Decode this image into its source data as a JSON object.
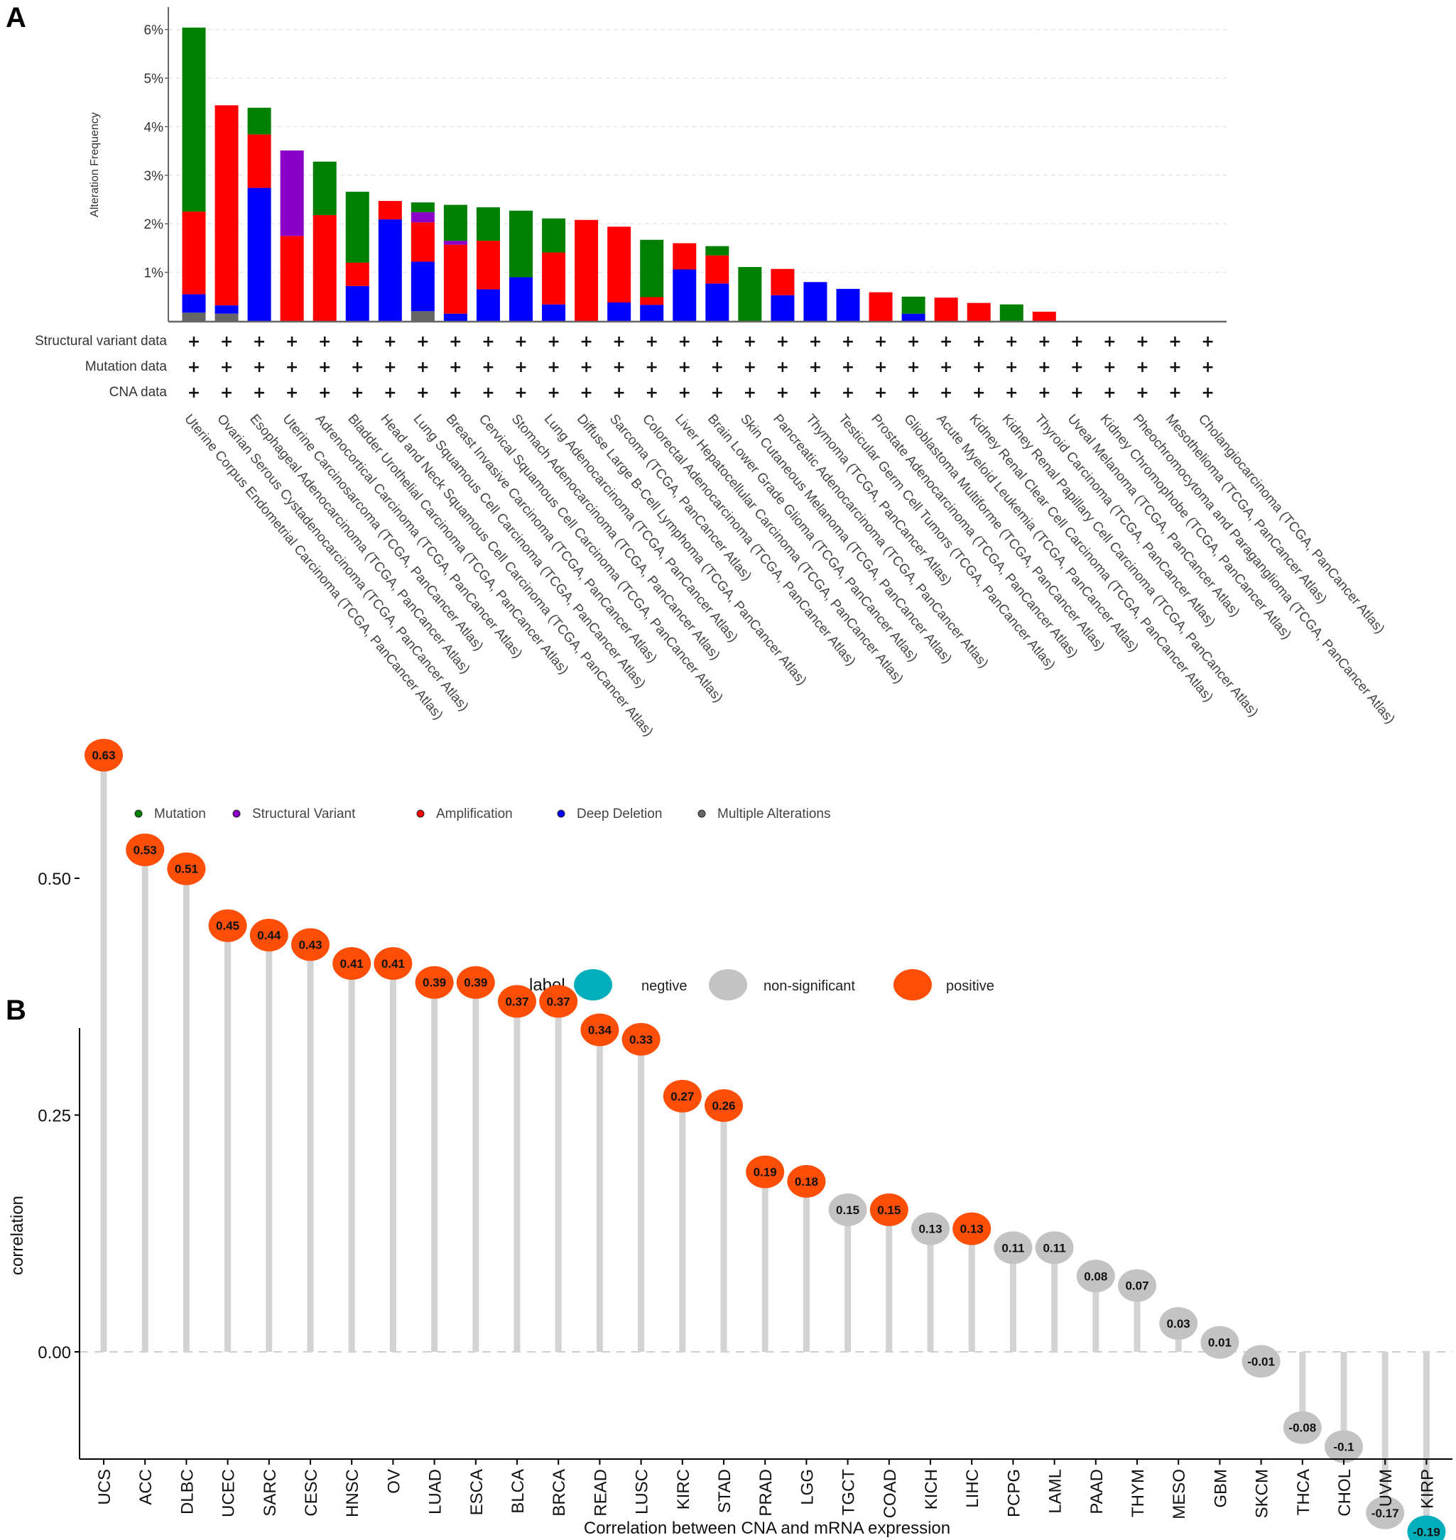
{
  "chart_data": [
    {
      "panel": "A",
      "type": "bar",
      "stacked": true,
      "title": "",
      "xlabel": "",
      "ylabel": "Alteration Frequency",
      "ylim": [
        0,
        6.5
      ],
      "yticks": [
        "1%",
        "2%",
        "3%",
        "4%",
        "5%",
        "6%"
      ],
      "ytick_values": [
        1,
        2,
        3,
        4,
        5,
        6
      ],
      "grid": true,
      "legend_position": "bottom",
      "segment_order": [
        "multiple",
        "deep_deletion",
        "amplification",
        "structural_variant",
        "mutation"
      ],
      "legend": [
        {
          "key": "mutation",
          "name": "Mutation",
          "color": "#008000"
        },
        {
          "key": "structural_variant",
          "name": "Structural Variant",
          "color": "#8B00C9"
        },
        {
          "key": "amplification",
          "name": "Amplification",
          "color": "#FF0000"
        },
        {
          "key": "deep_deletion",
          "name": "Deep Deletion",
          "color": "#0000FF"
        },
        {
          "key": "multiple",
          "name": "Multiple Alterations",
          "color": "#666666"
        }
      ],
      "row_labels": [
        "Structural variant data",
        "Mutation data",
        "CNA data"
      ],
      "row_marker": "+",
      "categories": [
        "Uterine Corpus Endometrial Carcinoma (TCGA, PanCancer Atlas)",
        "Ovarian Serous Cystadenocarcinoma (TCGA, PanCancer Atlas)",
        "Esophageal Adenocarcinoma (TCGA, PanCancer Atlas)",
        "Uterine Carcinosarcoma (TCGA, PanCancer Atlas)",
        "Adrenocortical Carcinoma (TCGA, PanCancer Atlas)",
        "Bladder Urothelial Carcinoma (TCGA, PanCancer Atlas)",
        "Head and Neck Squamous Cell Carcinoma (TCGA, PanCancer Atlas)",
        "Lung Squamous Cell Carcinoma (TCGA, PanCancer Atlas)",
        "Breast Invasive Carcinoma (TCGA, PanCancer Atlas)",
        "Cervical Squamous Cell Carcinoma (TCGA, PanCancer Atlas)",
        "Stomach Adenocarcinoma (TCGA, PanCancer Atlas)",
        "Lung Adenocarcinoma (TCGA, PanCancer Atlas)",
        "Diffuse Large B-Cell Lymphoma (TCGA, PanCancer Atlas)",
        "Sarcoma (TCGA, PanCancer Atlas)",
        "Colorectal Adenocarcinoma (TCGA, PanCancer Atlas)",
        "Liver Hepatocellular Carcinoma (TCGA, PanCancer Atlas)",
        "Brain Lower Grade Glioma (TCGA, PanCancer Atlas)",
        "Skin Cutaneous Melanoma (TCGA, PanCancer Atlas)",
        "Pancreatic Adenocarcinoma (TCGA, PanCancer Atlas)",
        "Thymoma (TCGA, PanCancer Atlas)",
        "Testicular Germ Cell Tumors (TCGA, PanCancer Atlas)",
        "Prostate Adenocarcinoma (TCGA, PanCancer Atlas)",
        "Glioblastoma Multiforme (TCGA, PanCancer Atlas)",
        "Acute Myeloid Leukemia (TCGA, PanCancer Atlas)",
        "Kidney Renal Clear Cell Carcinoma (TCGA, PanCancer Atlas)",
        "Kidney Renal Papillary Cell Carcinoma (TCGA, PanCancer Atlas)",
        "Thyroid Carcinoma (TCGA, PanCancer Atlas)",
        "Uveal Melanoma (TCGA, PanCancer Atlas)",
        "Kidney Chromophobe (TCGA, PanCancer Atlas)",
        "Pheochromocytoma and Paraganglioma (TCGA, PanCancer Atlas)",
        "Mesothelioma (TCGA, PanCancer Atlas)",
        "Cholangiocarcinoma (TCGA, PanCancer Atlas)"
      ],
      "series": [
        {
          "key": "mutation",
          "name": "Mutation",
          "values": [
            3.79,
            0,
            0.55,
            0,
            1.1,
            1.46,
            0,
            0.2,
            0.74,
            0.69,
            1.37,
            0.7,
            0,
            0,
            1.18,
            0,
            0.19,
            1.11,
            0,
            0,
            0,
            0,
            0.35,
            0,
            0,
            0.34,
            0,
            0,
            0,
            0,
            0,
            0
          ]
        },
        {
          "key": "structural_variant",
          "name": "Structural Variant",
          "values": [
            0,
            0,
            0,
            1.76,
            0,
            0,
            0,
            0.21,
            0.08,
            0,
            0,
            0,
            0,
            0,
            0,
            0,
            0,
            0,
            0,
            0,
            0,
            0,
            0,
            0,
            0,
            0,
            0,
            0,
            0,
            0,
            0,
            0
          ]
        },
        {
          "key": "amplification",
          "name": "Amplification",
          "values": [
            1.7,
            4.12,
            1.1,
            1.75,
            2.18,
            0.48,
            0.38,
            0.81,
            1.42,
            1.0,
            0,
            1.07,
            2.08,
            1.56,
            0.16,
            0.54,
            0.58,
            0,
            0.54,
            0,
            0,
            0.59,
            0,
            0.48,
            0.37,
            0,
            0.19,
            0,
            0,
            0,
            0,
            0
          ]
        },
        {
          "key": "deep_deletion",
          "name": "Deep Deletion",
          "values": [
            0.38,
            0.17,
            2.74,
            0,
            0,
            0.72,
            2.09,
            1.02,
            0.15,
            0.65,
            0.9,
            0.34,
            0,
            0.38,
            0.33,
            1.06,
            0.77,
            0,
            0.53,
            0.8,
            0.66,
            0,
            0.15,
            0,
            0,
            0,
            0,
            0,
            0,
            0,
            0,
            0
          ]
        },
        {
          "key": "multiple",
          "name": "Multiple Alterations",
          "values": [
            0.17,
            0.15,
            0,
            0,
            0,
            0,
            0,
            0.2,
            0,
            0,
            0,
            0,
            0,
            0,
            0,
            0,
            0,
            0,
            0,
            0,
            0,
            0,
            0,
            0,
            0,
            0,
            0,
            0,
            0,
            0,
            0,
            0
          ]
        }
      ]
    },
    {
      "panel": "B",
      "type": "scatter",
      "subtype": "lollipop",
      "title": "",
      "xlabel": "Correlation between CNA and mRNA expression",
      "ylabel": "correlation",
      "ylim": [
        -0.22,
        0.67
      ],
      "yticks": [
        "0.00",
        "0.25",
        "0.50"
      ],
      "ytick_values": [
        0,
        0.25,
        0.5
      ],
      "grid": false,
      "reference_line": 0,
      "legend_position": "top",
      "legend_title": "label",
      "legend": [
        {
          "key": "negtive",
          "name": "negtive",
          "color": "#00AFBB"
        },
        {
          "key": "non-significant",
          "name": "non-significant",
          "color": "#C3C3C3"
        },
        {
          "key": "positive",
          "name": "positive",
          "color": "#FC4E07"
        }
      ],
      "stem_color": "#D3D3D3",
      "categories": [
        "UCS",
        "ACC",
        "DLBC",
        "UCEC",
        "SARC",
        "CESC",
        "HNSC",
        "OV",
        "LUAD",
        "ESCA",
        "BLCA",
        "BRCA",
        "READ",
        "LUSC",
        "KIRC",
        "STAD",
        "PRAD",
        "LGG",
        "TGCT",
        "COAD",
        "KICH",
        "LIHC",
        "PCPG",
        "LAML",
        "PAAD",
        "THYM",
        "MESO",
        "GBM",
        "SKCM",
        "THCA",
        "CHOL",
        "UVM",
        "KIRP"
      ],
      "values": [
        0.63,
        0.53,
        0.51,
        0.45,
        0.44,
        0.43,
        0.41,
        0.41,
        0.39,
        0.39,
        0.37,
        0.37,
        0.34,
        0.33,
        0.27,
        0.26,
        0.19,
        0.18,
        0.15,
        0.15,
        0.13,
        0.13,
        0.11,
        0.11,
        0.08,
        0.07,
        0.03,
        0.01,
        -0.01,
        -0.08,
        -0.1,
        -0.17,
        -0.19
      ],
      "value_labels": [
        "0.63",
        "0.53",
        "0.51",
        "0.45",
        "0.44",
        "0.43",
        "0.41",
        "0.41",
        "0.39",
        "0.39",
        "0.37",
        "0.37",
        "0.34",
        "0.33",
        "0.27",
        "0.26",
        "0.19",
        "0.18",
        "0.15",
        "0.15",
        "0.13",
        "0.13",
        "0.11",
        "0.11",
        "0.08",
        "0.07",
        "0.03",
        "0.01",
        "-0.01",
        "-0.08",
        "-0.1",
        "-0.17",
        "-0.19"
      ],
      "labels": [
        "positive",
        "positive",
        "positive",
        "positive",
        "positive",
        "positive",
        "positive",
        "positive",
        "positive",
        "positive",
        "positive",
        "positive",
        "positive",
        "positive",
        "positive",
        "positive",
        "positive",
        "positive",
        "non-significant",
        "positive",
        "non-significant",
        "positive",
        "non-significant",
        "non-significant",
        "non-significant",
        "non-significant",
        "non-significant",
        "non-significant",
        "non-significant",
        "non-significant",
        "non-significant",
        "non-significant",
        "negtive"
      ]
    }
  ],
  "panels": {
    "a_letter": "A",
    "b_letter": "B"
  }
}
